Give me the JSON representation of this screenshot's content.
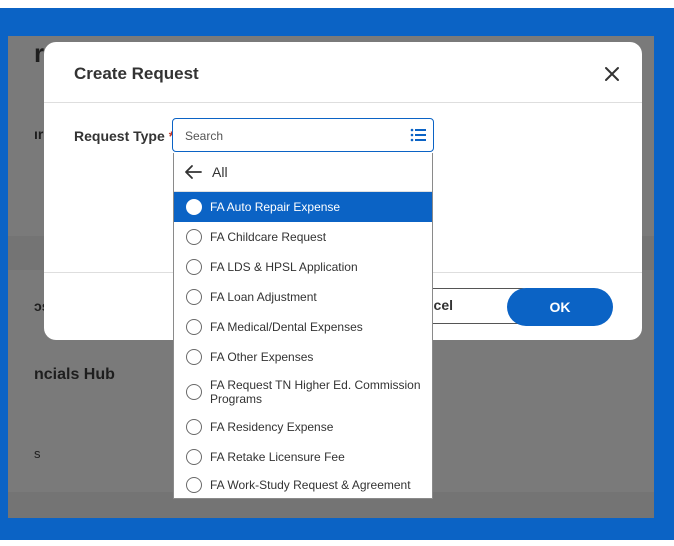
{
  "background": {
    "fragments": [
      {
        "id": "frag-r",
        "text": "r"
      },
      {
        "id": "frag-ir",
        "text": "ır"
      },
      {
        "id": "frag-os",
        "text": "ɔs"
      },
      {
        "id": "frag-hub",
        "text": "ncials Hub"
      },
      {
        "id": "frag-s",
        "text": "s"
      }
    ]
  },
  "modal": {
    "title": "Create Request",
    "field_label": "Request Type",
    "required_marker": "*",
    "cancel_label": "ncel",
    "ok_label": "OK"
  },
  "search": {
    "placeholder": "Search",
    "value": ""
  },
  "dropdown": {
    "header_label": "All",
    "items": [
      {
        "label": "FA Auto Repair Expense",
        "selected": true
      },
      {
        "label": "FA Childcare Request",
        "selected": false
      },
      {
        "label": "FA LDS & HPSL Application",
        "selected": false
      },
      {
        "label": "FA Loan Adjustment",
        "selected": false
      },
      {
        "label": "FA Medical/Dental Expenses",
        "selected": false
      },
      {
        "label": "FA Other Expenses",
        "selected": false
      },
      {
        "label": "FA Request TN Higher Ed. Commission Programs",
        "selected": false
      },
      {
        "label": "FA Residency Expense",
        "selected": false
      },
      {
        "label": "FA Retake Licensure Fee",
        "selected": false
      },
      {
        "label": "FA Work-Study Request & Agreement",
        "selected": false
      }
    ]
  },
  "colors": {
    "accent": "#0b63c5",
    "required": "#c0392b",
    "backdrop": "#7a7a7a"
  }
}
